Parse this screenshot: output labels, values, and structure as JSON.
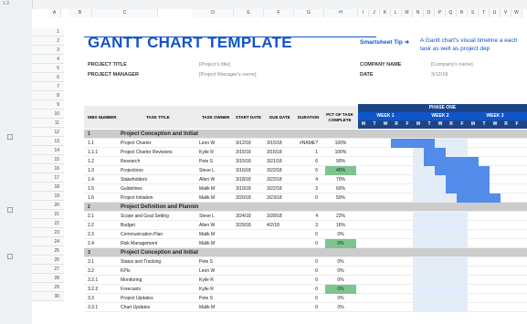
{
  "colors": {
    "accent": "#1155cc",
    "phase": "#1c4587",
    "bar": "#4a86e8",
    "green": "#7fc48f",
    "section": "#cccccc"
  },
  "top_header": {
    "label": "1 2",
    "col_letters": [
      "A",
      "B",
      "C",
      "D",
      "E",
      "F",
      "G",
      "H",
      "I",
      "J",
      "K",
      "L",
      "M",
      "N",
      "O",
      "P",
      "Q",
      "R",
      "S",
      "T",
      "U",
      "V",
      "W"
    ]
  },
  "title": "GANTT CHART TEMPLATE",
  "tip": {
    "label": "Smartsheet Tip ➜",
    "text": "A Gantt chart's visual timeline a each task as well as project dep"
  },
  "project": {
    "title_label": "PROJECT TITLE",
    "title_value": "[Project's title]",
    "manager_label": "PROJECT MANAGER",
    "manager_value": "[Project Manager's name]",
    "company_label": "COMPANY NAME",
    "company_value": "[Company's name]",
    "date_label": "DATE",
    "date_value": "3/12/18"
  },
  "headers": {
    "wbs": "WBS NUMBER",
    "task": "TASK TITLE",
    "owner": "TASK OWNER",
    "start": "START DATE",
    "due": "DUE DATE",
    "duration": "DURATION",
    "pct": "PCT OF TASK COMPLETE",
    "phase": "PHASE ONE",
    "weeks": [
      "WEEK 1",
      "WEEK 2",
      "WEEK 3"
    ],
    "days": [
      "M",
      "T",
      "W",
      "R",
      "F",
      "M",
      "T",
      "W",
      "R",
      "F",
      "M",
      "T",
      "W",
      "R",
      "F"
    ]
  },
  "row_numbers": [
    "1",
    "2",
    "3",
    "4",
    "5",
    "6",
    "7",
    "8",
    "9",
    "10",
    "11",
    "12",
    "13",
    "14",
    "15",
    "16",
    "17",
    "18",
    "19",
    "20",
    "21",
    "22",
    "23",
    "24",
    "25",
    "26",
    "27",
    "28",
    "29",
    "30"
  ],
  "rows": [
    {
      "wbs": "1",
      "task": "Project Conception and Initiat",
      "owner": "",
      "start": "",
      "due": "",
      "duration": "",
      "pct": "",
      "section": true
    },
    {
      "wbs": "1.1",
      "task": "Project Charter",
      "owner": "Leon W",
      "start": "3/12/18",
      "due": "3/15/18",
      "duration": "#NAME?",
      "pct": "100%",
      "bar": [
        3,
        4
      ]
    },
    {
      "wbs": "1.1.1",
      "task": "Project Charter Revisions",
      "owner": "Kylie R",
      "start": "3/15/18",
      "due": "3/16/18",
      "duration": "1",
      "pct": "100%",
      "bar": [
        6,
        2
      ]
    },
    {
      "wbs": "1.2",
      "task": "Research",
      "owner": "Pete S",
      "start": "3/15/18",
      "due": "3/21/18",
      "duration": "6",
      "pct": "90%",
      "bar": [
        6,
        5
      ]
    },
    {
      "wbs": "1.3",
      "task": "Projections",
      "owner": "Steve L",
      "start": "3/16/18",
      "due": "3/22/18",
      "duration": "6",
      "pct": "40%",
      "green": true,
      "bar": [
        7,
        5
      ]
    },
    {
      "wbs": "1.4",
      "task": "Stakeholders",
      "owner": "Allen W",
      "start": "3/18/18",
      "due": "3/22/18",
      "duration": "4",
      "pct": "70%",
      "bar": [
        8,
        4
      ]
    },
    {
      "wbs": "1.5",
      "task": "Guidelines",
      "owner": "Malik M",
      "start": "3/19/18",
      "due": "3/22/18",
      "duration": "3",
      "pct": "60%",
      "bar": [
        8,
        4
      ]
    },
    {
      "wbs": "1.6",
      "task": "Project Initiation",
      "owner": "Malik M",
      "start": "3/20/18",
      "due": "3/23/18",
      "duration": "0",
      "pct": "50%",
      "bar": [
        9,
        4
      ]
    },
    {
      "wbs": "2",
      "task": "Project Definition and Plannin",
      "owner": "",
      "start": "",
      "due": "",
      "duration": "",
      "pct": "",
      "section": true
    },
    {
      "wbs": "2.1",
      "task": "Scope and Goal Setting",
      "owner": "Steve L",
      "start": "3/24/18",
      "due": "3/28/18",
      "duration": "4",
      "pct": "22%"
    },
    {
      "wbs": "2.2",
      "task": "Budget",
      "owner": "Allen W",
      "start": "3/29/18",
      "due": "4/2/18",
      "duration": "3",
      "pct": "16%"
    },
    {
      "wbs": "2.3",
      "task": "Communication Plan",
      "owner": "Malik M",
      "start": "",
      "due": "",
      "duration": "0",
      "pct": "0%"
    },
    {
      "wbs": "2.4",
      "task": "Risk Management",
      "owner": "Malik M",
      "start": "",
      "due": "",
      "duration": "0",
      "pct": "0%",
      "green": true
    },
    {
      "wbs": "3",
      "task": "Project Conception and Initiat",
      "owner": "",
      "start": "",
      "due": "",
      "duration": "",
      "pct": "",
      "section": true
    },
    {
      "wbs": "3.1",
      "task": "Status and Tracking",
      "owner": "Pete S",
      "start": "",
      "due": "",
      "duration": "0",
      "pct": "0%"
    },
    {
      "wbs": "3.2",
      "task": "KPIs",
      "owner": "Leon W",
      "start": "",
      "due": "",
      "duration": "0",
      "pct": "0%"
    },
    {
      "wbs": "3.2.1",
      "task": "Monitoring",
      "owner": "Kylie R",
      "start": "",
      "due": "",
      "duration": "0",
      "pct": "0%"
    },
    {
      "wbs": "3.2.2",
      "task": "Forecasts",
      "owner": "Kylie R",
      "start": "",
      "due": "",
      "duration": "0",
      "pct": "0%",
      "green": true
    },
    {
      "wbs": "3.3",
      "task": "Project Updates",
      "owner": "Pete S",
      "start": "",
      "due": "",
      "duration": "0",
      "pct": "0%"
    },
    {
      "wbs": "3.3.1",
      "task": "Chart Updates",
      "owner": "Malik M",
      "start": "",
      "due": "",
      "duration": "0",
      "pct": "0%"
    }
  ]
}
